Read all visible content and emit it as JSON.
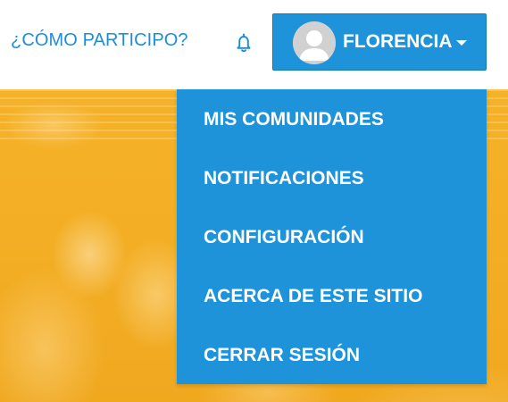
{
  "header": {
    "participate_link": "¿CÓMO PARTICIPO?",
    "notifications_icon": "bell-icon",
    "user": {
      "name": "FLORENCIA",
      "avatar_icon": "default-avatar-icon",
      "caret_icon": "caret-down-icon"
    }
  },
  "user_menu": {
    "items": [
      {
        "label": "MIS COMUNIDADES"
      },
      {
        "label": "NOTIFICACIONES"
      },
      {
        "label": "CONFIGURACIÓN"
      },
      {
        "label": "ACERCA DE ESTE SITIO"
      },
      {
        "label": "CERRAR SESIÓN"
      }
    ]
  },
  "colors": {
    "header_bg": "#ffffff",
    "link_blue": "#1f8dd6",
    "menu_blue": "#1e93d9",
    "hero_yellow": "#f4b32a",
    "menu_text": "#ffffff"
  }
}
